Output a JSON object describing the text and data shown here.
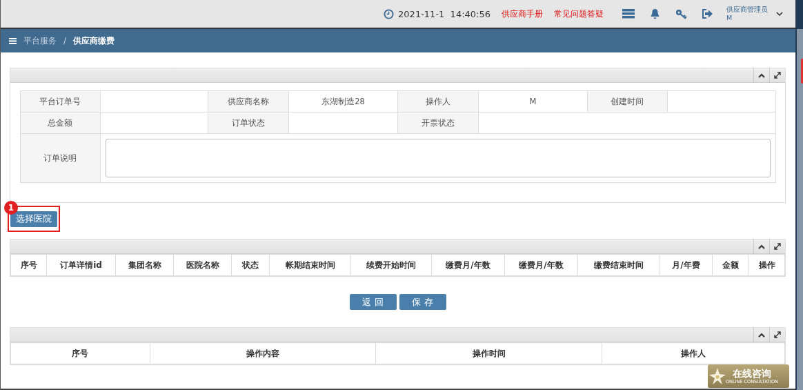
{
  "top_bar": {
    "datetime": "2021-11-1  14:40:56",
    "links": [
      "供应商手册",
      "常见问题答疑"
    ],
    "user": {
      "role": "供应商管理员",
      "account": "M"
    }
  },
  "breadcrumb": [
    "平台服务",
    "/",
    "供应商缴费"
  ],
  "order_form": {
    "rows": [
      [
        {
          "label": "平台订单号"
        },
        {
          "label": "供应商名称",
          "value": "东湖制造28"
        },
        {
          "label": "操作人",
          "value": "M"
        },
        {
          "label": "创建时间"
        }
      ],
      [
        {
          "label": "总金额"
        },
        {
          "label": "订单状态"
        },
        {
          "label": "开票状态"
        }
      ]
    ],
    "note_label": "订单说明"
  },
  "callout": {
    "number": "1",
    "button": "选择医院"
  },
  "detail_table": {
    "columns": [
      "序号",
      "订单详情id",
      "集团名称",
      "医院名称",
      "状态",
      "帐期结束时间",
      "续费开始时间",
      "缴费月/年数",
      "缴费月/年数",
      "缴费结束时间",
      "月/年费",
      "金额",
      "操作"
    ]
  },
  "actions": [
    "返 回",
    "保 存"
  ],
  "log_table": {
    "columns": [
      "序号",
      "操作内容",
      "操作时间",
      "操作人"
    ]
  },
  "consult_badge": {
    "title": "在线咨询",
    "subtitle": "ONLINE CONSULTATION"
  }
}
